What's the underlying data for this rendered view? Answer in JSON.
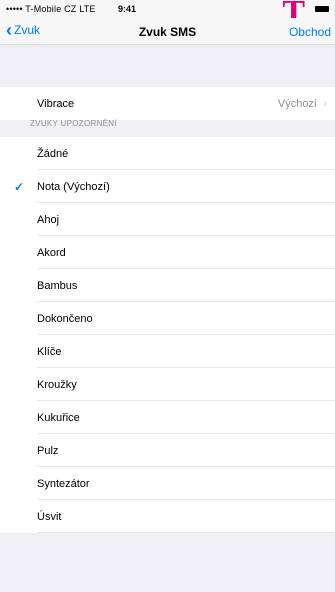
{
  "status_bar": {
    "carrier": "••••• T-Mobile CZ  LTE",
    "time": "9:41"
  },
  "nav": {
    "back_label": "Zvuk",
    "title": "Zvuk SMS",
    "action_label": "Obchod"
  },
  "vibration": {
    "label": "Vibrace",
    "value": "Výchozí"
  },
  "section_header": "ZVUKY UPOZORNĚNÍ",
  "sounds": [
    {
      "label": "Žádné",
      "selected": false
    },
    {
      "label": "Nota (Výchozí)",
      "selected": true
    },
    {
      "label": "Ahoj",
      "selected": false
    },
    {
      "label": "Akord",
      "selected": false
    },
    {
      "label": "Bambus",
      "selected": false
    },
    {
      "label": "Dokončeno",
      "selected": false
    },
    {
      "label": "Klíče",
      "selected": false
    },
    {
      "label": "Kroužky",
      "selected": false
    },
    {
      "label": "Kukuřice",
      "selected": false
    },
    {
      "label": "Pulz",
      "selected": false
    },
    {
      "label": "Syntezátor",
      "selected": false
    },
    {
      "label": "Úsvit",
      "selected": false
    }
  ],
  "colors": {
    "accent": "#007aff",
    "brand": "#e2007a"
  }
}
